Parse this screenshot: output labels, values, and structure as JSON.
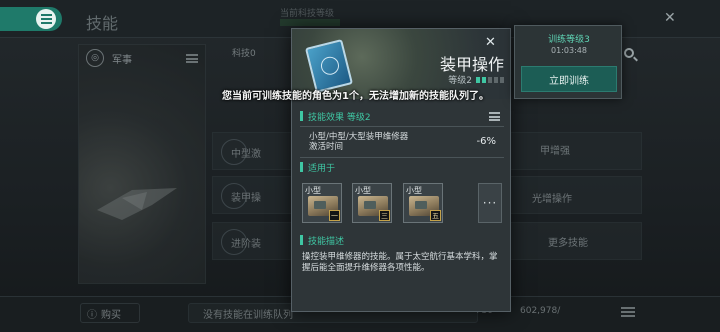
{
  "header": {
    "title": "技能",
    "current_level_label": "当前科技等级",
    "list_label": "训练"
  },
  "left_panel": {
    "category": "军事"
  },
  "skill_list": {
    "tab": "科技0",
    "rows": [
      {
        "label": "中型激"
      },
      {
        "label": "装甲操"
      },
      {
        "label": "进阶装"
      }
    ],
    "right_items": [
      "甲增强",
      "光增操作",
      "更多技能"
    ]
  },
  "bottom": {
    "buy_label": "购买",
    "queue_text": "没有技能在训练队列",
    "plus_value": "+30",
    "money": "602,978/"
  },
  "notice": "您当前可训练技能的角色为1个，无法增加新的技能队列了。",
  "skill_modal": {
    "name": "装甲操作",
    "level_label": "等级2",
    "level_bars_on": 2,
    "level_bars_total": 5,
    "effect_header": "技能效果 等级2",
    "effect": {
      "name_line1": "小型/中型/大型装甲维修器",
      "name_line2": "激活时间",
      "value": "-6%"
    },
    "applies_header": "适用于",
    "slots": [
      {
        "size": "小型",
        "grade": "一"
      },
      {
        "size": "小型",
        "grade": "三"
      },
      {
        "size": "小型",
        "grade": "五"
      }
    ],
    "more": "···",
    "desc_header": "技能描述",
    "description": "操控装甲维修器的技能。属于太空航行基本学科，掌握后能全面提升维修器各项性能。"
  },
  "train_popup": {
    "title": "训练等级3",
    "time": "01:03:48",
    "button": "立即训练"
  },
  "colors": {
    "accent": "#3fc6a3",
    "button": "#1c5d55",
    "menu": "#1f7a6a"
  }
}
